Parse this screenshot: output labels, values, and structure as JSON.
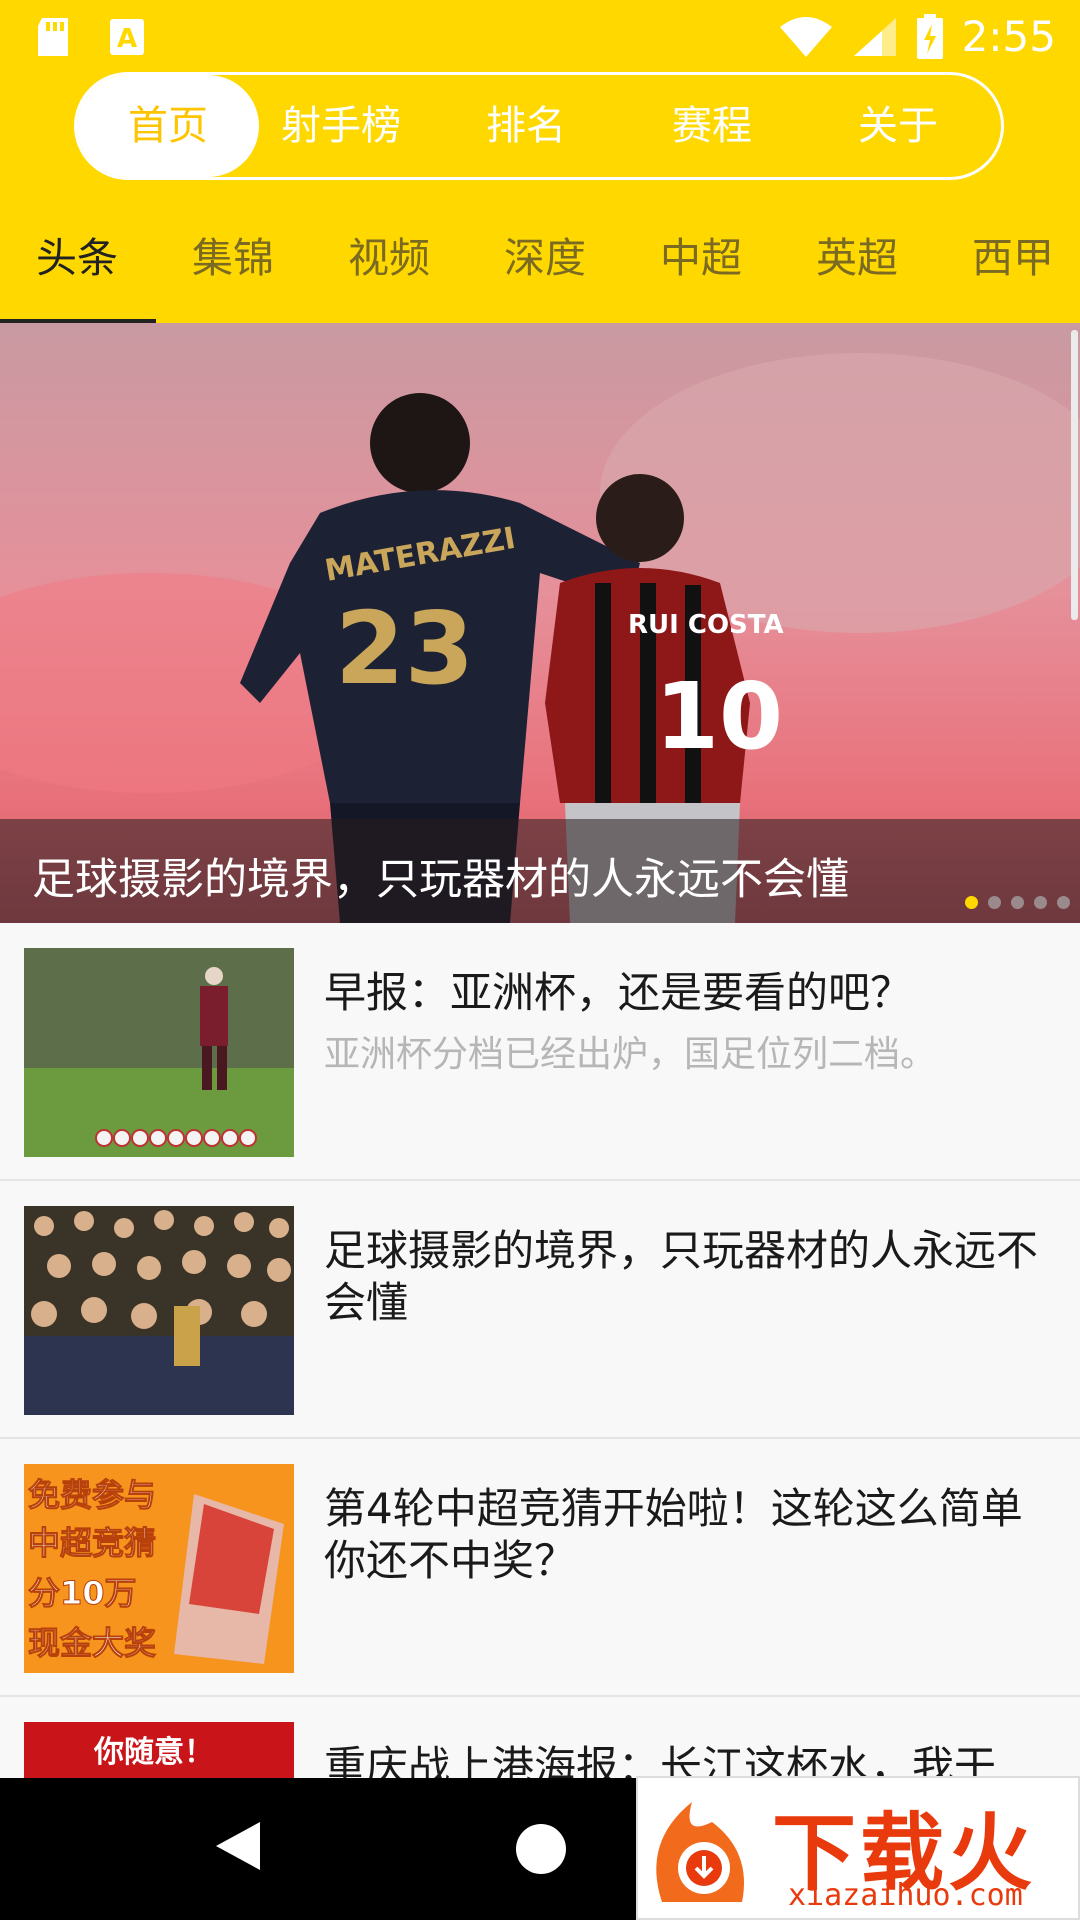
{
  "statusbar": {
    "time": "2:55"
  },
  "top_nav": {
    "items": [
      "首页",
      "射手榜",
      "排名",
      "赛程",
      "关于"
    ],
    "active_index": 0
  },
  "tabs": {
    "items": [
      "头条",
      "集锦",
      "视频",
      "深度",
      "中超",
      "英超",
      "西甲"
    ],
    "active_index": 0
  },
  "hero": {
    "caption": "足球摄影的境界，只玩器材的人永远不会懂",
    "jersey_left_name": "MATERAZZI",
    "jersey_left_number": "23",
    "jersey_right_name": "RUI COSTA",
    "jersey_right_number": "10",
    "carousel_count": 5,
    "carousel_active": 0
  },
  "news": [
    {
      "title": "早报：亚洲杯，还是要看的吧？",
      "subtitle": "亚洲杯分档已经出炉，国足位列二档。"
    },
    {
      "title": "足球摄影的境界，只玩器材的人永远不会懂",
      "subtitle": ""
    },
    {
      "title": "第4轮中超竞猜开始啦！这轮这么简单你还不中奖？",
      "subtitle": "",
      "thumb_text": [
        "免费参与",
        "中超竞猜",
        "分10万",
        "现金大奖"
      ]
    },
    {
      "title": "重庆战上港海报：长江这杯水，我干",
      "subtitle": "",
      "thumb_text": "你随意！"
    }
  ],
  "watermark": {
    "brand": "下载火",
    "url": "xiazaihuo.com"
  },
  "colors": {
    "accent": "#FFD800",
    "active_pill_text": "#FFC400"
  }
}
